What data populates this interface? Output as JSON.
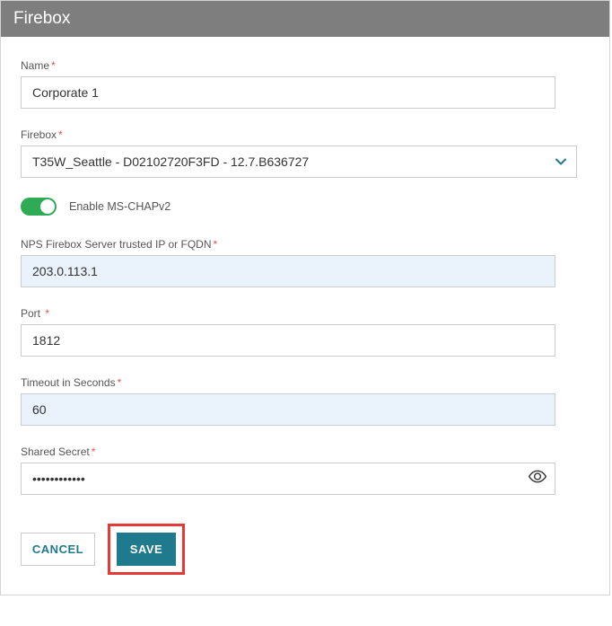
{
  "header": {
    "title": "Firebox"
  },
  "fields": {
    "name": {
      "label": "Name",
      "value": "Corporate 1"
    },
    "firebox": {
      "label": "Firebox",
      "selected": "T35W_Seattle - D02102720F3FD - 12.7.B636727"
    },
    "mschap": {
      "label": "Enable MS-CHAPv2"
    },
    "nps_ip": {
      "label": "NPS Firebox Server trusted IP or FQDN",
      "value": "203.0.113.1"
    },
    "port": {
      "label": "Port",
      "value": "1812"
    },
    "timeout": {
      "label": "Timeout in Seconds",
      "value": "60"
    },
    "shared_secret": {
      "label": "Shared Secret",
      "value": "••••••••••••"
    }
  },
  "buttons": {
    "cancel": "Cancel",
    "save": "Save"
  }
}
